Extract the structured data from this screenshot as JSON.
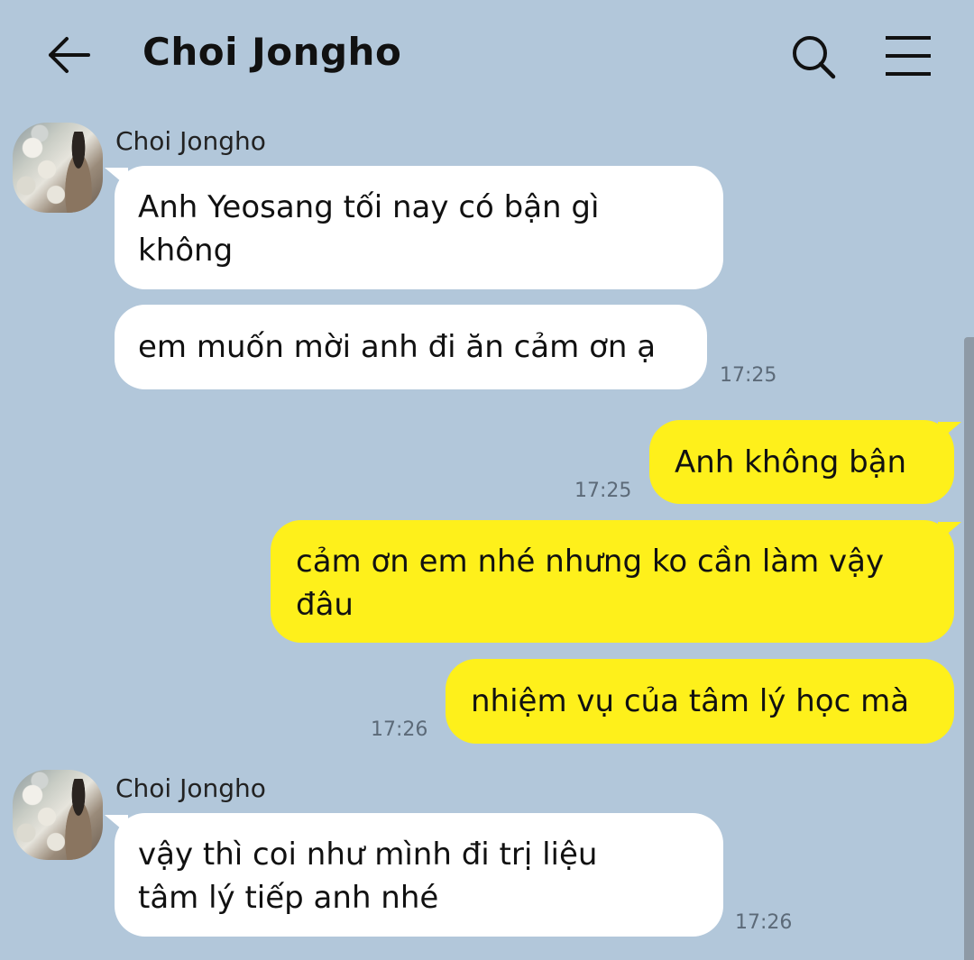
{
  "header": {
    "title": "Choi Jongho"
  },
  "messages": [
    {
      "sender": "Choi Jongho",
      "lines": [
        "Anh Yeosang tối nay có bận gì",
        "không"
      ]
    },
    {
      "text": "em muốn mời anh đi ăn cảm ơn ạ",
      "time": "17:25"
    },
    {
      "text": "Anh không bận",
      "time": "17:25"
    },
    {
      "lines": [
        "cảm ơn em nhé nhưng ko cần làm vậy",
        "đâu"
      ]
    },
    {
      "text": "nhiệm vụ của tâm lý học mà",
      "time": "17:26"
    },
    {
      "sender": "Choi Jongho",
      "lines": [
        "vậy thì coi như mình đi trị liệu",
        "tâm lý tiếp anh nhé"
      ],
      "time": "17:26"
    }
  ],
  "colors": {
    "background": "#b2c7da",
    "incoming_bubble": "#ffffff",
    "outgoing_bubble": "#fef01b",
    "timestamp": "#5c6a78"
  },
  "icons": {
    "back": "back-arrow-icon",
    "search": "search-icon",
    "menu": "hamburger-menu-icon"
  }
}
